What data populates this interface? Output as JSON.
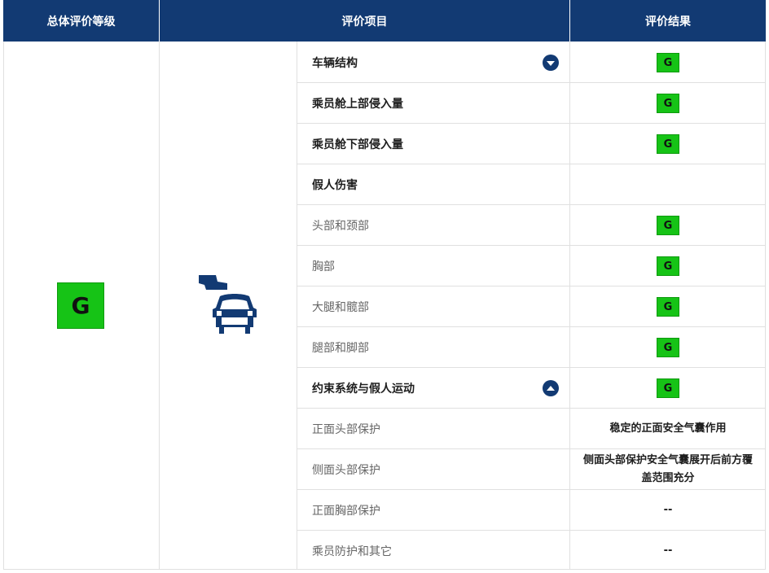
{
  "header": {
    "overall": "总体评价等级",
    "items": "评价项目",
    "result": "评价结果"
  },
  "overall_rating": "G",
  "rows": [
    {
      "label": "车辆结构",
      "style": "bold",
      "result": "G",
      "toggle": "chevron-down"
    },
    {
      "label": "乘员舱上部侵入量",
      "style": "bold",
      "result": "G"
    },
    {
      "label": "乘员舱下部侵入量",
      "style": "bold",
      "result": "G"
    },
    {
      "label": "假人伤害",
      "style": "bold",
      "result": ""
    },
    {
      "label": "头部和颈部",
      "style": "normal",
      "result": "G"
    },
    {
      "label": "胸部",
      "style": "normal",
      "result": "G"
    },
    {
      "label": "大腿和髋部",
      "style": "normal",
      "result": "G"
    },
    {
      "label": "腿部和脚部",
      "style": "normal",
      "result": "G"
    },
    {
      "label": "约束系统与假人运动",
      "style": "bold",
      "result": "G",
      "toggle": "chevron-up"
    },
    {
      "label": "正面头部保护",
      "style": "normal",
      "result_text": "稳定的正面安全气囊作用"
    },
    {
      "label": "侧面头部保护",
      "style": "normal",
      "result_text": "侧面头部保护安全气囊展开后前方覆盖范围充分"
    },
    {
      "label": "正面胸部保护",
      "style": "normal",
      "result_text": "--"
    },
    {
      "label": "乘员防护和其它",
      "style": "normal",
      "result_text": "--"
    }
  ],
  "colors": {
    "header_bg": "#123a73",
    "good_green": "#16c316",
    "icon_blue": "#123a73"
  }
}
